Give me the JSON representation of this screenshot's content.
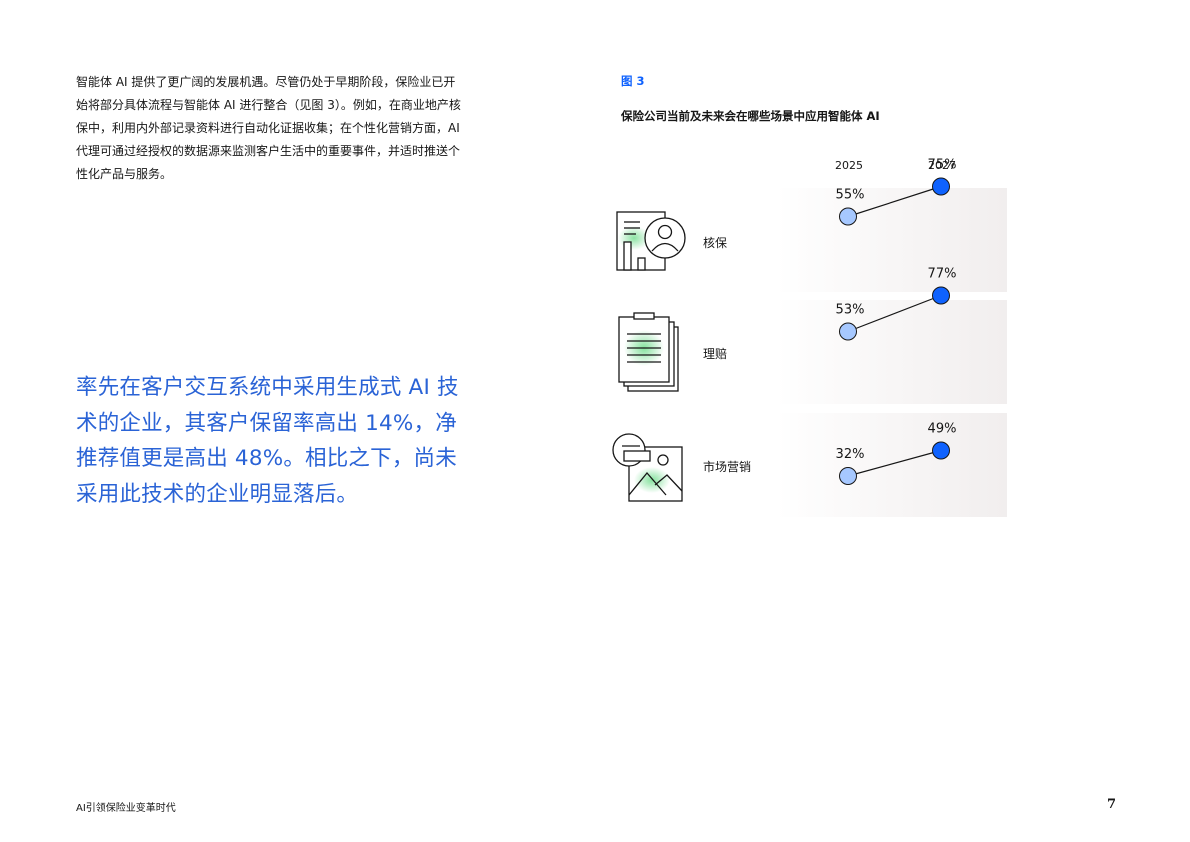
{
  "intro_text": "智能体 AI 提供了更广阔的发展机遇。尽管仍处于早期阶段，保险业已开始将部分具体流程与智能体 AI 进行整合（见图 3）。例如，在商业地产核保中，利用内外部记录资料进行自动化证据收集；在个性化营销方面，AI 代理可通过经授权的数据源来监测客户生活中的重要事件，并适时推送个性化产品与服务。",
  "quote_text": "率先在客户交互系统中采用生成式 AI 技术的企业，其客户保留率高出 14%，净推荐值更是高出 48%。相比之下，尚未采用此技术的企业明显落后。",
  "figure": {
    "label": "图 3",
    "title": "保险公司当前及未来会在哪些场景中应用智能体 AI"
  },
  "chart_data": {
    "type": "dumbbell",
    "title": "保险公司当前及未来会在哪些场景中应用智能体 AI",
    "x_labels": [
      "2025",
      "2027"
    ],
    "unit": "%",
    "rows": [
      {
        "label": "核保",
        "icon": "document-person-icon",
        "v2025": 55,
        "v2027": 75
      },
      {
        "label": "理赔",
        "icon": "clipboard-icon",
        "v2025": 53,
        "v2027": 77
      },
      {
        "label": "市场营销",
        "icon": "image-card-icon",
        "v2025": 32,
        "v2027": 49
      }
    ],
    "colors": {
      "2025": "#a6c8ff",
      "2027": "#0f62fe"
    }
  },
  "footer": {
    "doc_title": "AI引领保险业变革时代",
    "page_number": "7"
  }
}
